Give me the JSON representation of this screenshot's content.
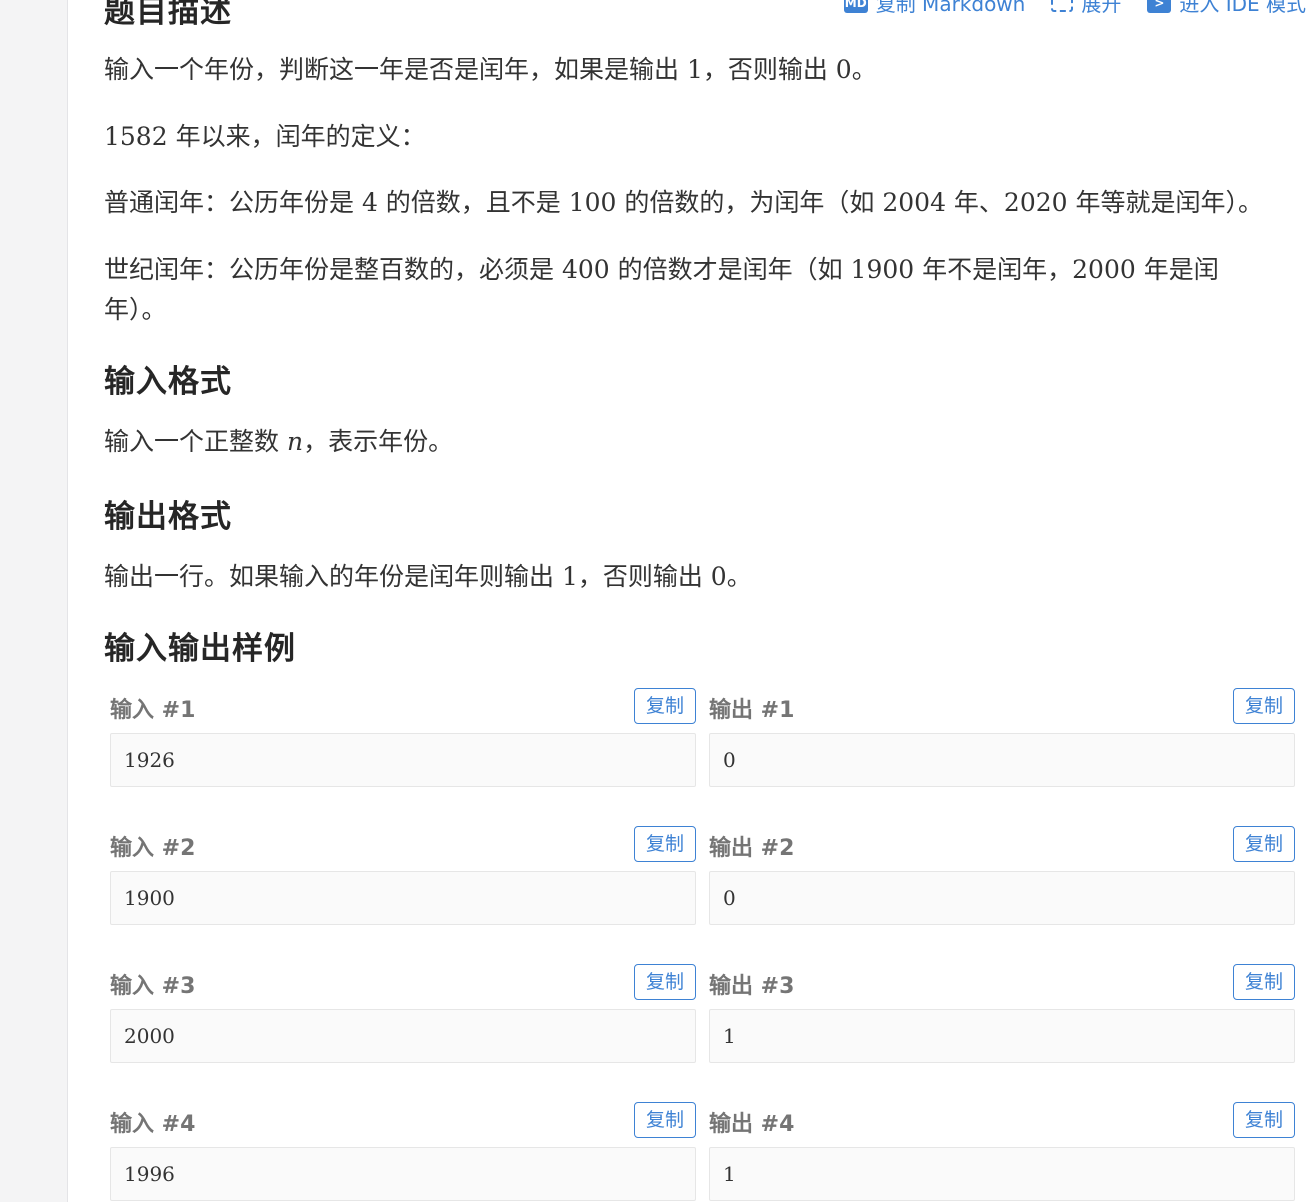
{
  "toolbar": {
    "copy_markdown": "复制 Markdown",
    "expand": "展开",
    "ide_mode": "进入 IDE 模式",
    "md_icon": "MD"
  },
  "description": {
    "title": "题目描述",
    "p1": "输入一个年份，判断这一年是否是闰年，如果是输出 1，否则输出 0。",
    "p2": "1582 年以来，闰年的定义：",
    "p3": "普通闰年：公历年份是 4 的倍数，且不是 100 的倍数的，为闰年（如 2004 年、2020 年等就是闰年）。",
    "p4_line1": "世纪闰年：公历年份是整百数的，必须是 400 的倍数才是闰年（如 1900 年不是闰年，2000 年是闰",
    "p4_line2": "年）。"
  },
  "input_format": {
    "title": "输入格式",
    "text_before": "输入一个正整数 ",
    "var": "n",
    "text_after": "，表示年份。"
  },
  "output_format": {
    "title": "输出格式",
    "text": "输出一行。如果输入的年份是闰年则输出 1，否则输出 0。"
  },
  "samples": {
    "title": "输入输出样例",
    "copy_label": "复制",
    "items": [
      {
        "input_label": "输入 #1",
        "input": "1926",
        "output_label": "输出 #1",
        "output": "0"
      },
      {
        "input_label": "输入 #2",
        "input": "1900",
        "output_label": "输出 #2",
        "output": "0"
      },
      {
        "input_label": "输入 #3",
        "input": "2000",
        "output_label": "输出 #3",
        "output": "1"
      },
      {
        "input_label": "输入 #4",
        "input": "1996",
        "output_label": "输出 #4",
        "output": "1"
      }
    ]
  },
  "colors": {
    "accent": "#3e82d4",
    "label_gray": "#757575",
    "box_bg": "#fafafa"
  }
}
